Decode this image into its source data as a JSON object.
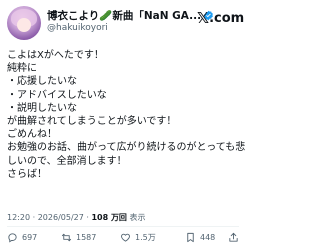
{
  "author": {
    "name": "博衣こより🥒新曲「NaN GA...",
    "handle": "@hakuikoyori"
  },
  "brand": {
    "logo_mark": "𝕏",
    "logo_text": ".com"
  },
  "tweet": {
    "lines": [
      "こよはXがへたです！",
      "純粋に",
      "・応援したいな",
      "・アドバイスしたいな",
      "・説明したいな",
      "が曲解されてしまうことが多いです！",
      "ごめんね！",
      "お勉強のお話、曲がって広がり続けるのがとっても悲",
      "しいので、全部消します！",
      "さらば！"
    ]
  },
  "meta": {
    "time": "12:20",
    "sep": "·",
    "date": "2026/05/27",
    "views": "108 万回",
    "views_label": "表示"
  },
  "actions": {
    "reply_count": "697",
    "retweet_count": "1587",
    "like_count": "1.5万",
    "bookmark_count": "448"
  },
  "colors": {
    "text": "#0f1419",
    "secondary": "#536471",
    "verified": "#1d9bf0",
    "divider": "#eff3f4"
  }
}
